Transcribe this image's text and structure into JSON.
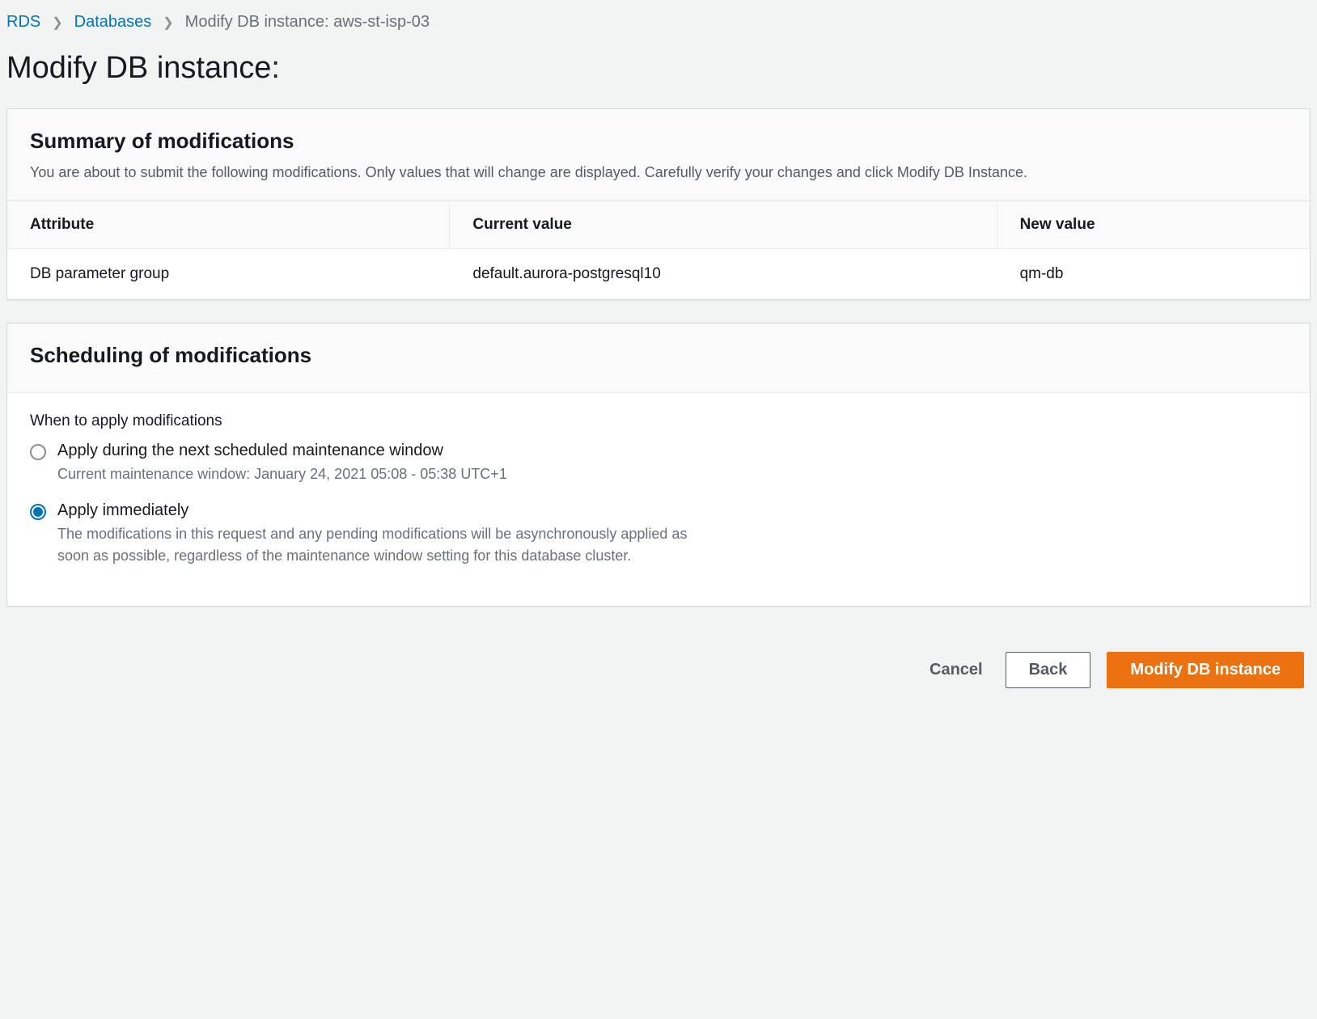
{
  "breadcrumb": {
    "items": [
      {
        "label": "RDS"
      },
      {
        "label": "Databases"
      },
      {
        "label": "Modify DB instance: aws-st-isp-03"
      }
    ]
  },
  "page": {
    "title": "Modify DB instance:"
  },
  "summary": {
    "heading": "Summary of modifications",
    "description": "You are about to submit the following modifications. Only values that will change are displayed. Carefully verify your changes and click Modify DB Instance.",
    "columns": {
      "attribute": "Attribute",
      "current": "Current value",
      "new": "New value"
    },
    "rows": [
      {
        "attribute": "DB parameter group",
        "current": "default.aurora-postgresql10",
        "new": "qm-db"
      }
    ]
  },
  "scheduling": {
    "heading": "Scheduling of modifications",
    "field_label": "When to apply modifications",
    "options": [
      {
        "label": "Apply during the next scheduled maintenance window",
        "description": "Current maintenance window: January 24, 2021 05:08 - 05:38 UTC+1",
        "selected": false
      },
      {
        "label": "Apply immediately",
        "description": "The modifications in this request and any pending modifications will be asynchronously applied as soon as possible, regardless of the maintenance window setting for this database cluster.",
        "selected": true
      }
    ]
  },
  "actions": {
    "cancel": "Cancel",
    "back": "Back",
    "submit": "Modify DB instance"
  }
}
